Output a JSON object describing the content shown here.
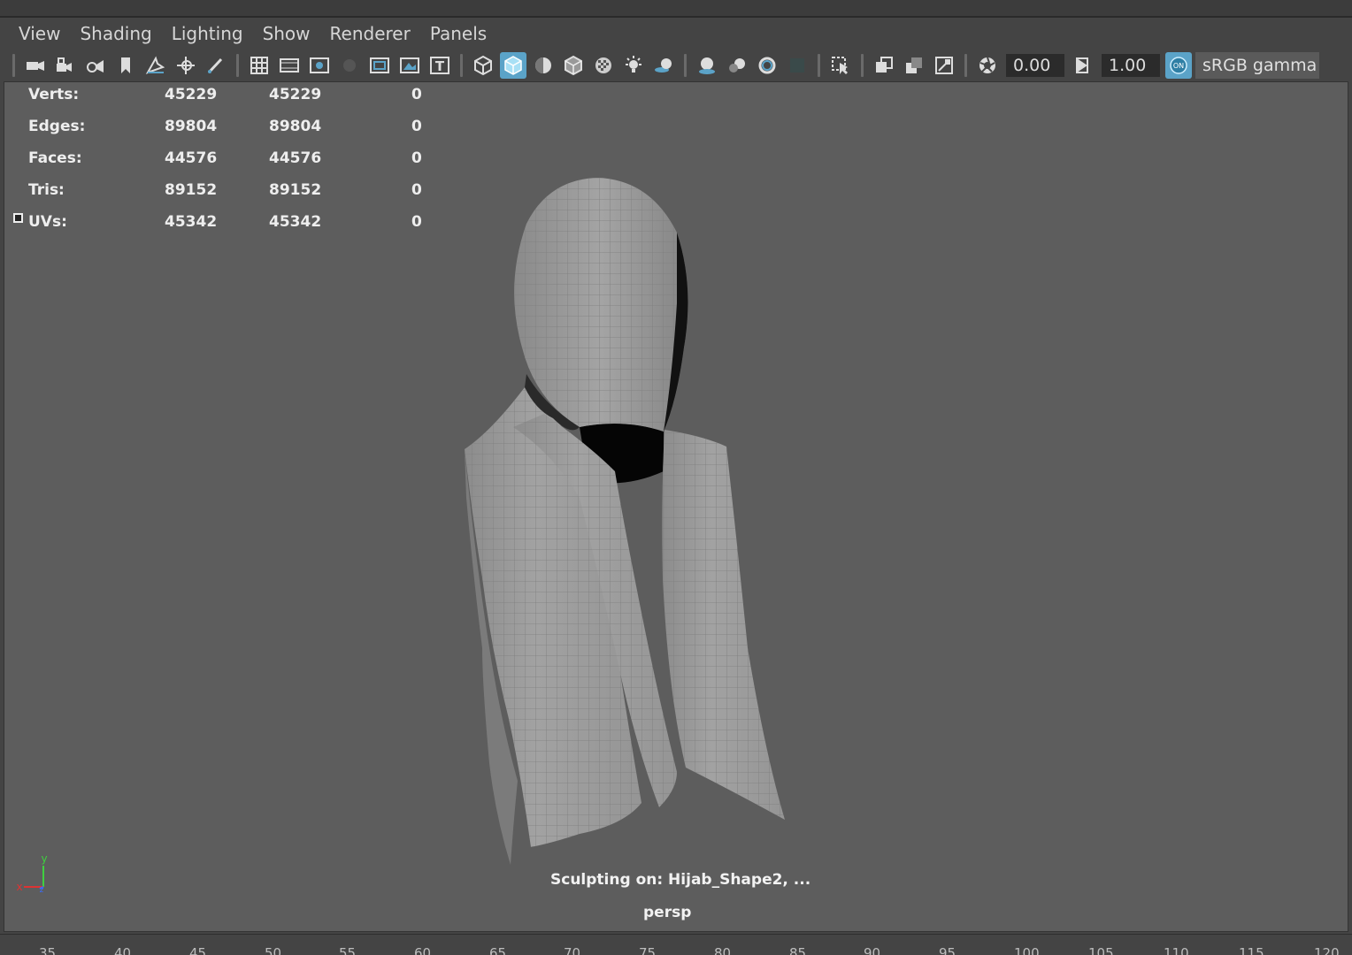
{
  "menu": [
    "View",
    "Shading",
    "Lighting",
    "Show",
    "Renderer",
    "Panels"
  ],
  "toolbar": {
    "exposure_value": "0.00",
    "gamma_value": "1.00",
    "color_space": "sRGB gamma"
  },
  "hud": {
    "rows": [
      {
        "label": "Verts:",
        "c1": "45229",
        "c2": "45229",
        "c3": "0"
      },
      {
        "label": "Edges:",
        "c1": "89804",
        "c2": "89804",
        "c3": "0"
      },
      {
        "label": "Faces:",
        "c1": "44576",
        "c2": "44576",
        "c3": "0"
      },
      {
        "label": "Tris:",
        "c1": "89152",
        "c2": "89152",
        "c3": "0"
      },
      {
        "label": "UVs:",
        "c1": "45342",
        "c2": "45342",
        "c3": "0"
      }
    ]
  },
  "viewport": {
    "sculpt_message": "Sculpting on: Hijab_Shape2, ...",
    "camera": "persp",
    "axis_labels": {
      "x": "x",
      "y": "y",
      "z": "z"
    }
  },
  "timeline": {
    "ticks": [
      "35",
      "40",
      "45",
      "50",
      "55",
      "60",
      "65",
      "70",
      "75",
      "80",
      "85",
      "90",
      "95",
      "100",
      "105",
      "110",
      "115",
      "120"
    ]
  },
  "colors": {
    "viewport_bg": "#5d5d5d",
    "active_accent": "#5ba3c8",
    "ui_bg": "#444444"
  }
}
